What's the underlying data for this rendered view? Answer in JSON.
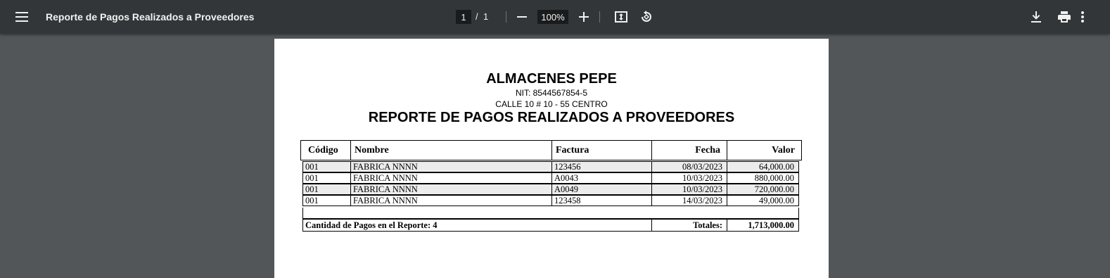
{
  "toolbar": {
    "title": "Reporte de Pagos Realizados a Proveedores",
    "current_page": "1",
    "page_separator": "/",
    "total_pages": "1",
    "zoom": "100%",
    "icons": [
      "menu-icon",
      "zoom-out-icon",
      "zoom-in-icon",
      "fit-page-icon",
      "rotate-icon",
      "download-icon",
      "print-icon",
      "more-options-icon"
    ]
  },
  "document": {
    "company": "ALMACENES PEPE",
    "nit": "NIT: 8544567854-5",
    "address": "CALLE 10 # 10 - 55 CENTRO",
    "report_title": "REPORTE DE PAGOS REALIZADOS A PROVEEDORES",
    "table": {
      "headers": [
        "Código",
        "Nombre",
        "Factura",
        "Fecha",
        "Valor"
      ],
      "rows": [
        [
          "001",
          "FABRICA NNNN",
          "123456",
          "08/03/2023",
          "64,000.00"
        ],
        [
          "001",
          "FABRICA NNNN",
          "A0043",
          "10/03/2023",
          "880,000.00"
        ],
        [
          "001",
          "FABRICA NNNN",
          "A0049",
          "10/03/2023",
          "720,000.00"
        ],
        [
          "001",
          "FABRICA NNNN",
          "123458",
          "14/03/2023",
          "49,000.00"
        ]
      ],
      "footer": {
        "count_label": "Cantidad de Pagos en el Reporte: 4",
        "totals_label": "Totales:",
        "totals_value": "1,713,000.00"
      }
    }
  },
  "colors": {
    "toolbar_bg": "#323639",
    "viewer_bg": "#525659",
    "page_bg": "#ffffff",
    "row_shade": "#ececec"
  }
}
